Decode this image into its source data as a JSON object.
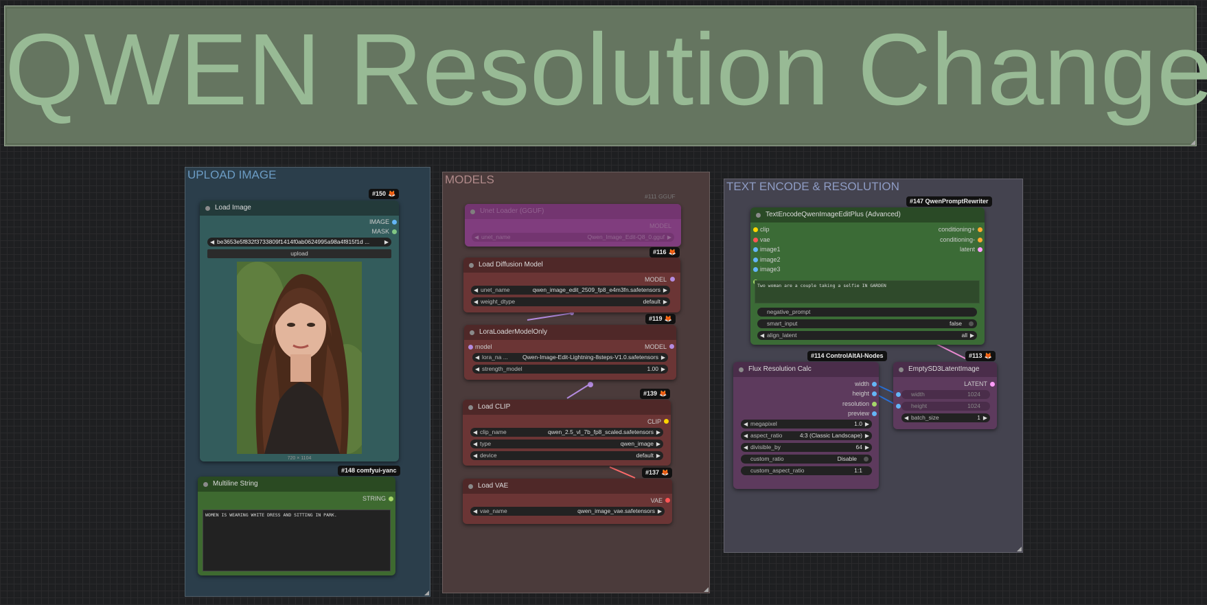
{
  "title_group": {
    "label": "QWEN Resolution Change"
  },
  "groups": {
    "upload": "UPLOAD IMAGE",
    "models": "MODELS",
    "text": "TEXT ENCODE & RESOLUTION"
  },
  "colors": {
    "title_bg": "#657560",
    "upload_bg": "#2b3e4b",
    "models_bg": "#4b3b3b",
    "text_bg": "#44434f"
  },
  "nodes": {
    "load_image": {
      "badge": "#150",
      "title": "Load Image",
      "outputs": [
        "IMAGE",
        "MASK"
      ],
      "file": "be3653e5f832f3733809f1414f0ab0624995a98a4f815f1d ...",
      "upload_label": "upload",
      "dims": "720 × 1104"
    },
    "multiline": {
      "badge": "#148 comfyui-yanc",
      "title": "Multiline String",
      "output": "STRING",
      "text": "WOMEN IS WEARING WHITE DRESS AND SITTING IN PARK."
    },
    "unet_gguf": {
      "badge": "#111 GGUF",
      "title": "Unet Loader (GGUF)",
      "output": "MODEL",
      "w_label": "unet_name",
      "w_value": "Qwen_Image_Edit-Q8_0.gguf"
    },
    "load_diffusion": {
      "badge": "#116",
      "title": "Load Diffusion Model",
      "output": "MODEL",
      "widgets": [
        {
          "label": "unet_name",
          "value": "qwen_image_edit_2509_fp8_e4m3fn.safetensors"
        },
        {
          "label": "weight_dtype",
          "value": "default"
        }
      ]
    },
    "lora": {
      "badge": "#119",
      "title": "LoraLoaderModelOnly",
      "input": "model",
      "output": "MODEL",
      "widgets": [
        {
          "label": "lora_na ...",
          "value": "Qwen-Image-Edit-Lightning-8steps-V1.0.safetensors"
        },
        {
          "label": "strength_model",
          "value": "1.00"
        }
      ]
    },
    "load_clip": {
      "badge": "#139",
      "title": "Load CLIP",
      "output": "CLIP",
      "widgets": [
        {
          "label": "clip_name",
          "value": "qwen_2.5_vl_7b_fp8_scaled.safetensors"
        },
        {
          "label": "type",
          "value": "qwen_image"
        },
        {
          "label": "device",
          "value": "default"
        }
      ]
    },
    "load_vae": {
      "badge": "#137",
      "title": "Load VAE",
      "output": "VAE",
      "widgets": [
        {
          "label": "vae_name",
          "value": "qwen_image_vae.safetensors"
        }
      ]
    },
    "text_encode": {
      "badge": "#147 QwenPromptRewriter",
      "title": "TextEncodeQwenImageEditPlus (Advanced)",
      "inputs": [
        "clip",
        "vae",
        "image1",
        "image2",
        "image3"
      ],
      "outputs": [
        "conditioning+",
        "conditioning-",
        "latent"
      ],
      "prompt": "Two woman are a couple taking a selfie IN GARDEN",
      "widgets": [
        {
          "label": "negative_prompt",
          "value": ""
        },
        {
          "label": "smart_input",
          "value": "false"
        },
        {
          "label": "align_latent",
          "value": "all"
        }
      ]
    },
    "flux_res": {
      "badge": "#114 ControlAltAI-Nodes",
      "title": "Flux Resolution Calc",
      "outputs": [
        "width",
        "height",
        "resolution",
        "preview"
      ],
      "widgets": [
        {
          "label": "megapixel",
          "value": "1.0"
        },
        {
          "label": "aspect_ratio",
          "value": "4:3 (Classic Landscape)"
        },
        {
          "label": "divisible_by",
          "value": "64"
        },
        {
          "label": "custom_ratio",
          "value": "Disable"
        },
        {
          "label": "custom_aspect_ratio",
          "value": "1:1"
        }
      ]
    },
    "empty_latent": {
      "badge": "#113",
      "title": "EmptySD3LatentImage",
      "output": "LATENT",
      "widgets": [
        {
          "label": "width",
          "value": "1024"
        },
        {
          "label": "height",
          "value": "1024"
        },
        {
          "label": "batch_size",
          "value": "1"
        }
      ]
    }
  }
}
